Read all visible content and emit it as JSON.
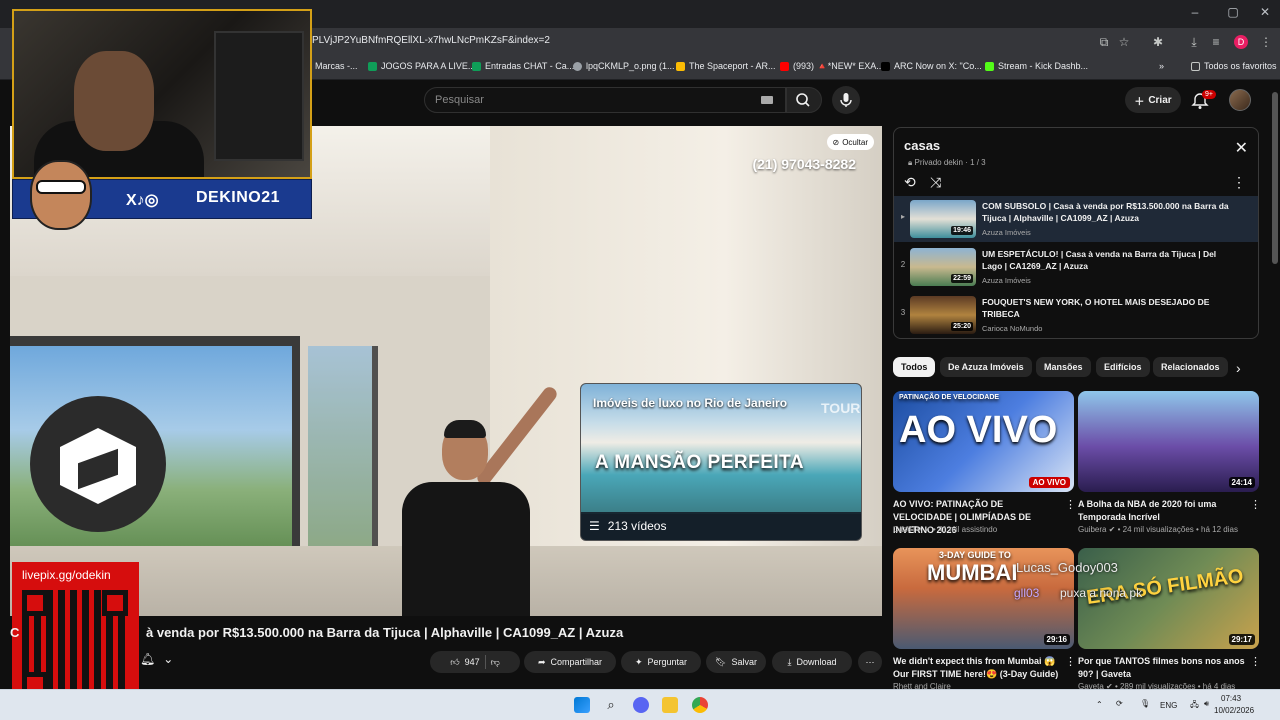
{
  "browser": {
    "url": "PLVjJP2YuBNfmRQEllXL-x7hwLNcPmKZsF&index=2",
    "profile_initial": "D",
    "bookmarks": [
      {
        "label": "Marcas -...",
        "color": "#f4b400"
      },
      {
        "label": "JOGOS PARA A LIVE...",
        "color": "#0f9d58"
      },
      {
        "label": "Entradas CHAT - Ca...",
        "color": "#0f9d58"
      },
      {
        "label": "lpqCKMLP_o.png (1...",
        "color": "#9aa0a6"
      },
      {
        "label": "The Spaceport - AR...",
        "color": "#fbbc04"
      },
      {
        "label": "(993) 🔺*NEW* EXA...",
        "color": "#ff0000"
      },
      {
        "label": "ARC Now on X: \"Co...",
        "color": "#000000"
      },
      {
        "label": "Stream - Kick Dashb...",
        "color": "#53fc18"
      }
    ],
    "bookmarks_folder": "Todos os favoritos",
    "window_controls": [
      "–",
      "▢",
      "✕"
    ]
  },
  "header": {
    "search_placeholder": "Pesquisar",
    "create_label": "Criar",
    "notification_count": "9+"
  },
  "player": {
    "phone_overlay": "(21) 97043-8282",
    "hide_label": "Ocultar",
    "playlist_card": {
      "title": "Imóveis de luxo no Rio de Janeiro",
      "headline": "A MANSÃO PERFEITA",
      "corner_text": "TOUR",
      "video_count": "213 vídeos"
    }
  },
  "stream_overlay": {
    "social_handle": "DEKINO21",
    "social_icons": "X♪◎",
    "livepix_url": "livepix.gg/odekin"
  },
  "video": {
    "title_prefix": "C",
    "title": "à venda por R$13.500.000 na Barra da Tijuca | Alphaville | CA1099_AZ | Azuza",
    "likes": "947",
    "share_label": "Compartilhar",
    "ask_label": "Perguntar",
    "save_label": "Salvar",
    "download_label": "Download"
  },
  "queue": {
    "title": "casas",
    "subtitle": "Privado dekin · 1 / 3",
    "items": [
      {
        "index": "▸",
        "title": "COM SUBSOLO | Casa à venda por R$13.500.000 na Barra da Tijuca | Alphaville | CA1099_AZ | Azuza",
        "channel": "Azuza Imóveis",
        "duration": "19:46",
        "active": true
      },
      {
        "index": "2",
        "title": "UM ESPETÁCULO! | Casa à venda na Barra da Tijuca | Del Lago | CA1269_AZ | Azuza",
        "channel": "Azuza Imóveis",
        "duration": "22:59",
        "active": false
      },
      {
        "index": "3",
        "title": "FOUQUET'S NEW YORK, O HOTEL MAIS DESEJADO DE TRIBECA",
        "channel": "Carioca NoMundo",
        "duration": "25:20",
        "active": false
      }
    ]
  },
  "chips": [
    "Todos",
    "De Azuza Imóveis",
    "Mansões",
    "Edifícios",
    "Relacionados"
  ],
  "recommendations": [
    {
      "title": "AO VIVO: PATINAÇÃO DE VELOCIDADE | OLIMPÍADAS DE INVERNO 2026",
      "meta": "CazéTV ✔ • 41 mil assistindo",
      "badge": "AO VIVO",
      "thumb_text": "AO VIVO",
      "thumb_sub": "PATINAÇÃO DE VELOCIDADE"
    },
    {
      "title": "A Bolha da NBA de 2020 foi uma Temporada Incrível",
      "meta": "Guibera ✔ • 24 mil visualizações • há 12 dias",
      "badge": "24:14",
      "thumb_text": "",
      "thumb_sub": ""
    },
    {
      "title": "We didn't expect this from Mumbai 😱 Our FIRST TIME here!😍 (3-Day Guide)",
      "meta": "Rhett and Claire",
      "badge": "29:16",
      "thumb_text": "MUMBAI",
      "thumb_sub": "3-DAY GUIDE TO"
    },
    {
      "title": "Por que TANTOS filmes bons nos anos 90? | Gaveta",
      "meta": "Gaveta ✔ • 289 mil visualizações • há 4 dias",
      "badge": "29:17",
      "thumb_text": "ERA SÓ FILMÃO",
      "thumb_sub": ""
    }
  ],
  "chat_overlay": [
    "Lucas_Godoy003",
    "gll03",
    "puxa a nona pk"
  ],
  "taskbar": {
    "language": "ENG",
    "time": "07:43",
    "date": "10/02/2026"
  }
}
